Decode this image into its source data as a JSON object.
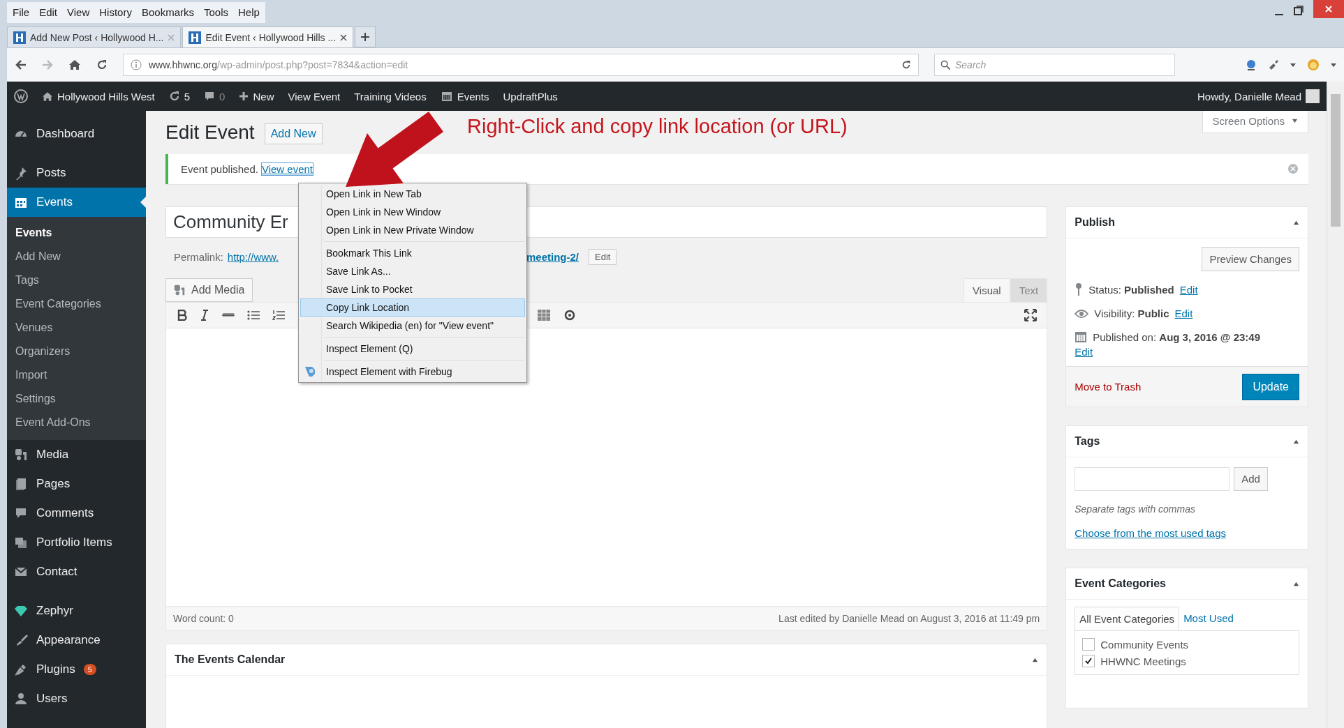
{
  "browser": {
    "menu": [
      "File",
      "Edit",
      "View",
      "History",
      "Bookmarks",
      "Tools",
      "Help"
    ],
    "tabs": [
      {
        "title": "Add New Post ‹ Hollywood H...",
        "selected": false
      },
      {
        "title": "Edit Event ‹ Hollywood Hills ...",
        "selected": true
      }
    ],
    "url": {
      "domain": "www.hhwnc.org",
      "path": "/wp-admin/post.php?post=7834&action=edit"
    },
    "search": {
      "placeholder": "Search"
    }
  },
  "admin_bar": {
    "site": "Hollywood Hills West",
    "updates": "5",
    "comments": "0",
    "new": "New",
    "links": [
      "View Event",
      "Training Videos"
    ],
    "events": "Events",
    "plugin": "UpdraftPlus",
    "greeting": "Howdy, Danielle Mead"
  },
  "sidebar": {
    "items": [
      {
        "label": "Dashboard",
        "selected": false
      },
      {
        "label": "Posts",
        "selected": false
      },
      {
        "label": "Events",
        "selected": true,
        "children": [
          {
            "label": "Events",
            "selected": true
          },
          {
            "label": "Add New",
            "selected": false
          },
          {
            "label": "Tags",
            "selected": false
          },
          {
            "label": "Event Categories",
            "selected": false
          },
          {
            "label": "Venues",
            "selected": false
          },
          {
            "label": "Organizers",
            "selected": false
          },
          {
            "label": "Import",
            "selected": false
          },
          {
            "label": "Settings",
            "selected": false
          },
          {
            "label": "Event Add-Ons",
            "selected": false
          }
        ]
      },
      {
        "label": "Media",
        "selected": false
      },
      {
        "label": "Pages",
        "selected": false
      },
      {
        "label": "Comments",
        "selected": false
      },
      {
        "label": "Portfolio Items",
        "selected": false
      },
      {
        "label": "Contact",
        "selected": false
      },
      {
        "label": "Zephyr",
        "selected": false
      },
      {
        "label": "Appearance",
        "selected": false
      },
      {
        "label": "Plugins",
        "selected": false,
        "badge": "5"
      },
      {
        "label": "Users",
        "selected": false
      }
    ]
  },
  "page": {
    "title": "Edit Event",
    "add_new": "Add New",
    "screen_options": "Screen Options",
    "notice": "Event published.",
    "notice_link": "View event",
    "annotation": "Right-Click and copy link location (or URL)"
  },
  "editor": {
    "title_value": "Community Er",
    "permalink_label": "Permalink:",
    "permalink_start": "http://www.",
    "permalink_end": "meeting-2/",
    "permalink_edit": "Edit",
    "add_media": "Add Media",
    "tabs": [
      {
        "label": "Visual",
        "selected": true
      },
      {
        "label": "Text",
        "selected": false
      }
    ],
    "word_count": "Word count: 0",
    "last_edited": "Last edited by Danielle Mead on August 3, 2016 at 11:49 pm"
  },
  "calendar_box": {
    "title": "The Events Calendar"
  },
  "context_menu": {
    "groups": [
      [
        {
          "label": "Open Link in New Tab",
          "selected": false
        },
        {
          "label": "Open Link in New Window",
          "selected": false
        },
        {
          "label": "Open Link in New Private Window",
          "selected": false
        }
      ],
      [
        {
          "label": "Bookmark This Link",
          "selected": false
        },
        {
          "label": "Save Link As...",
          "selected": false
        },
        {
          "label": "Save Link to Pocket",
          "selected": false
        },
        {
          "label": "Copy Link Location",
          "selected": true
        },
        {
          "label": "Search Wikipedia (en) for \"View event\"",
          "selected": false
        }
      ],
      [
        {
          "label": "Inspect Element (Q)",
          "selected": false
        }
      ],
      [
        {
          "label": "Inspect Element with Firebug",
          "selected": false
        }
      ]
    ]
  },
  "publish": {
    "title": "Publish",
    "preview": "Preview Changes",
    "status": "Status: **Published**",
    "status_edit": "Edit",
    "visibility": "Visibility: **Public**",
    "visibility_edit": "Edit",
    "published": "Published on: **Aug 3, 2016 @ 23:49**",
    "published_edit": "Edit",
    "trash": "Move to Trash",
    "update": "Update"
  },
  "tags": {
    "title": "Tags",
    "add": "Add",
    "hint": "Separate tags with commas",
    "link": "Choose from the most used tags"
  },
  "categories": {
    "title": "Event Categories",
    "tabs": [
      {
        "label": "All Event Categories",
        "selected": true
      },
      {
        "label": "Most Used",
        "selected": false
      }
    ],
    "items": [
      {
        "label": "Community Events",
        "checked": false
      },
      {
        "label": "HHWNC Meetings",
        "checked": true
      }
    ]
  }
}
